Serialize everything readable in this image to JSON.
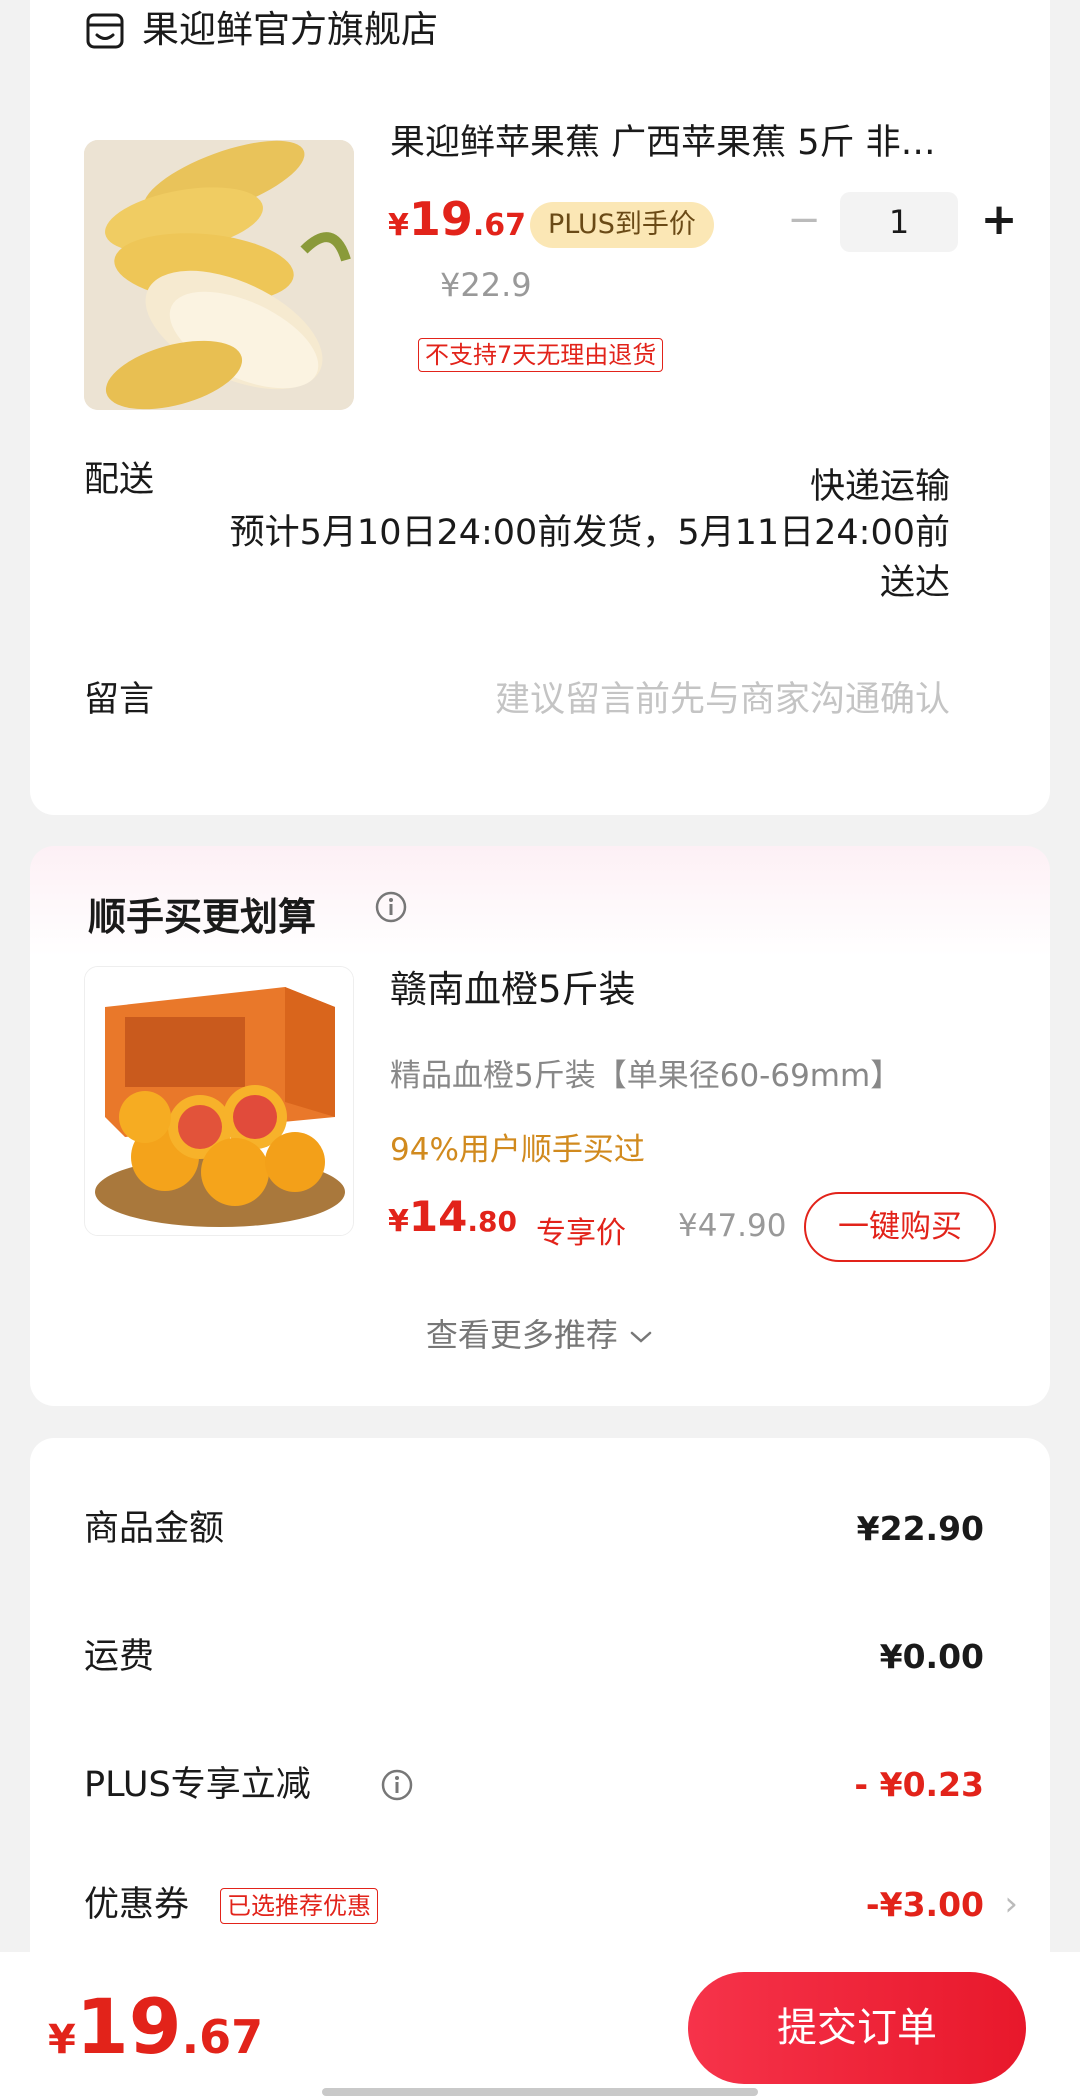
{
  "store": {
    "name": "果迎鲜官方旗舰店",
    "icon": "store-icon"
  },
  "product": {
    "title": "果迎鲜苹果蕉 广西苹果蕉 5斤 非…",
    "price_symbol": "¥",
    "price_integer": "19",
    "price_decimal": ".67",
    "plus_badge": "PLUS到手价",
    "original_price": "¥22.9",
    "quantity": "1",
    "minus_symbol": "−",
    "plus_symbol": "+",
    "return_policy": "不支持7天无理由退货"
  },
  "delivery": {
    "label": "配送",
    "type": "快递运输",
    "estimate_line1": "预计5月10日24:00前发货，5月11日24:00前",
    "estimate_line2": "送达"
  },
  "note": {
    "label": "留言",
    "placeholder": "建议留言前先与商家沟通确认"
  },
  "upsell": {
    "title": "顺手买更划算",
    "item": {
      "name": "赣南血橙5斤装",
      "description": "精品血橙5斤装【单果径60-69mm】",
      "bought_rate": "94%用户顺手买过",
      "price_symbol": "¥",
      "price_integer": "14",
      "price_decimal": ".80",
      "price_label": "专享价",
      "original_price": "¥47.90",
      "buy_button": "一键购买"
    },
    "more_link": "查看更多推荐"
  },
  "summary": {
    "rows": [
      {
        "label": "商品金额",
        "value": "¥22.90"
      },
      {
        "label": "运费",
        "value": "¥0.00"
      },
      {
        "label": "PLUS专享立减",
        "value": "- ¥0.23"
      },
      {
        "label": "优惠券",
        "tag": "已选推荐优惠",
        "value": "-¥3.00"
      }
    ]
  },
  "bottom": {
    "price_symbol": "¥",
    "price_integer": "19",
    "price_decimal": ".67",
    "submit_button": "提交订单"
  },
  "colors": {
    "accent_red": "#e2231a",
    "plus_gold": "#fbe7b5",
    "upsell_gold": "#d18a1e"
  }
}
